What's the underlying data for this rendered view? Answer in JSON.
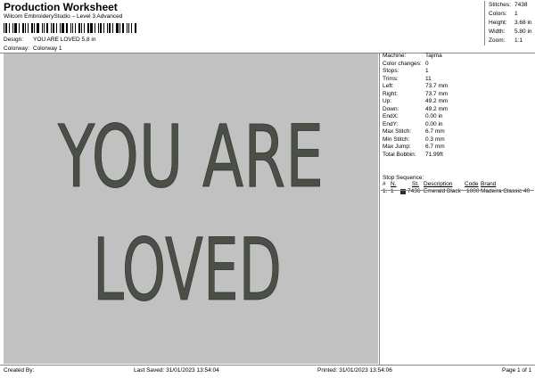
{
  "header": {
    "title": "Production Worksheet",
    "subtitle": "Wilcom EmbroideryStudio – Level 3 Advanced"
  },
  "design": {
    "label": "Design:",
    "value": "YOU ARE LOVED 5,8 in"
  },
  "colorway": {
    "label": "Colorway:",
    "value": "Colorway 1"
  },
  "stats": [
    {
      "label": "Stitches:",
      "value": "7438"
    },
    {
      "label": "Colors:",
      "value": "1"
    },
    {
      "label": "Height:",
      "value": "3.68 in"
    },
    {
      "label": "Width:",
      "value": "5.80 in"
    },
    {
      "label": "Zoom:",
      "value": "1:1"
    }
  ],
  "info": [
    {
      "label": "Machine:",
      "value": "Tajima"
    },
    {
      "label": "Color changes:",
      "value": "0"
    },
    {
      "label": "Stops:",
      "value": "1"
    },
    {
      "label": "Trims:",
      "value": "11"
    },
    {
      "label": "Left:",
      "value": "73.7 mm"
    },
    {
      "label": "Right:",
      "value": "73.7 mm"
    },
    {
      "label": "Up:",
      "value": "49.2 mm"
    },
    {
      "label": "Down:",
      "value": "49.2 mm"
    },
    {
      "label": "EndX:",
      "value": "0.00 in"
    },
    {
      "label": "EndY:",
      "value": "0.00 in"
    },
    {
      "label": "Max Stitch:",
      "value": "6.7 mm"
    },
    {
      "label": "Min Stitch:",
      "value": "0.3 mm"
    },
    {
      "label": "Max Jump:",
      "value": "6.7 mm"
    },
    {
      "label": "Total Bobbin:",
      "value": "71.99ft"
    }
  ],
  "stop_sequence": {
    "label": "Stop Sequence:",
    "headers": [
      "#",
      "N.",
      "St.",
      "Description",
      "Code",
      "Brand"
    ],
    "rows": [
      {
        "num": "1.",
        "n": "1",
        "color": "#2c2c2c",
        "st": "7436",
        "description": "Emerald Black",
        "code": "1000",
        "brand": "Madeira Classic 40"
      }
    ]
  },
  "canvas": {
    "background": "#c1c1c1",
    "thread_color": "#4a5048",
    "line1": "YOU ARE",
    "line2": "LOVED"
  },
  "footer": {
    "created_by": "Created By:",
    "last_saved": "Last Saved: 31/01/2023 13:54:04",
    "printed": "Printed: 31/01/2023 13:54:06",
    "page": "Page 1 of 1"
  }
}
